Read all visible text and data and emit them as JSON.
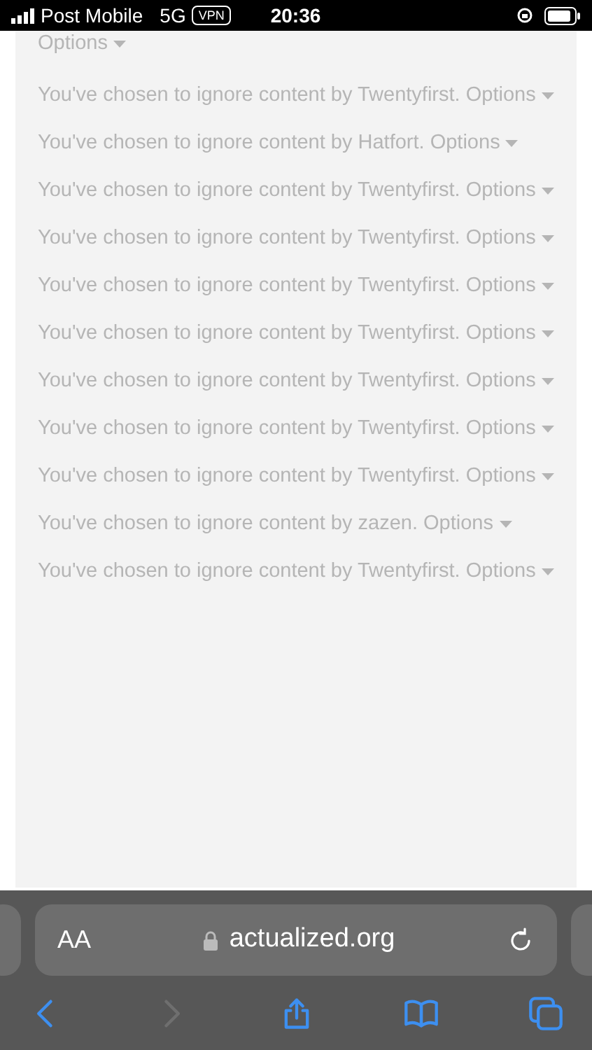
{
  "status_bar": {
    "carrier": "Post Mobile",
    "network": "5G",
    "vpn": "VPN",
    "time": "20:36"
  },
  "top_partial": {
    "options": "Options"
  },
  "notices": [
    {
      "message": "You've chosen to ignore content by Twentyfirst.",
      "options": "Options"
    },
    {
      "message": "You've chosen to ignore content by Hatfort.",
      "options": "Options"
    },
    {
      "message": "You've chosen to ignore content by Twentyfirst.",
      "options": "Options"
    },
    {
      "message": "You've chosen to ignore content by Twentyfirst.",
      "options": "Options"
    },
    {
      "message": "You've chosen to ignore content by Twentyfirst.",
      "options": "Options"
    },
    {
      "message": "You've chosen to ignore content by Twentyfirst.",
      "options": "Options"
    },
    {
      "message": "You've chosen to ignore content by Twentyfirst.",
      "options": "Options"
    },
    {
      "message": "You've chosen to ignore content by Twentyfirst.",
      "options": "Options"
    },
    {
      "message": "You've chosen to ignore content by Twentyfirst.",
      "options": "Options"
    },
    {
      "message": "You've chosen to ignore content by zazen.",
      "options": "Options"
    },
    {
      "message": "You've chosen to ignore content by Twentyfirst.",
      "options": "Options"
    }
  ],
  "address_bar": {
    "text_size": "AA",
    "url": "actualized.org"
  },
  "toolbar": [
    {
      "kind": "back",
      "disabled": false
    },
    {
      "kind": "forward",
      "disabled": true
    },
    {
      "kind": "share",
      "disabled": false
    },
    {
      "kind": "bookmarks",
      "disabled": false
    },
    {
      "kind": "tabs",
      "disabled": false
    }
  ]
}
